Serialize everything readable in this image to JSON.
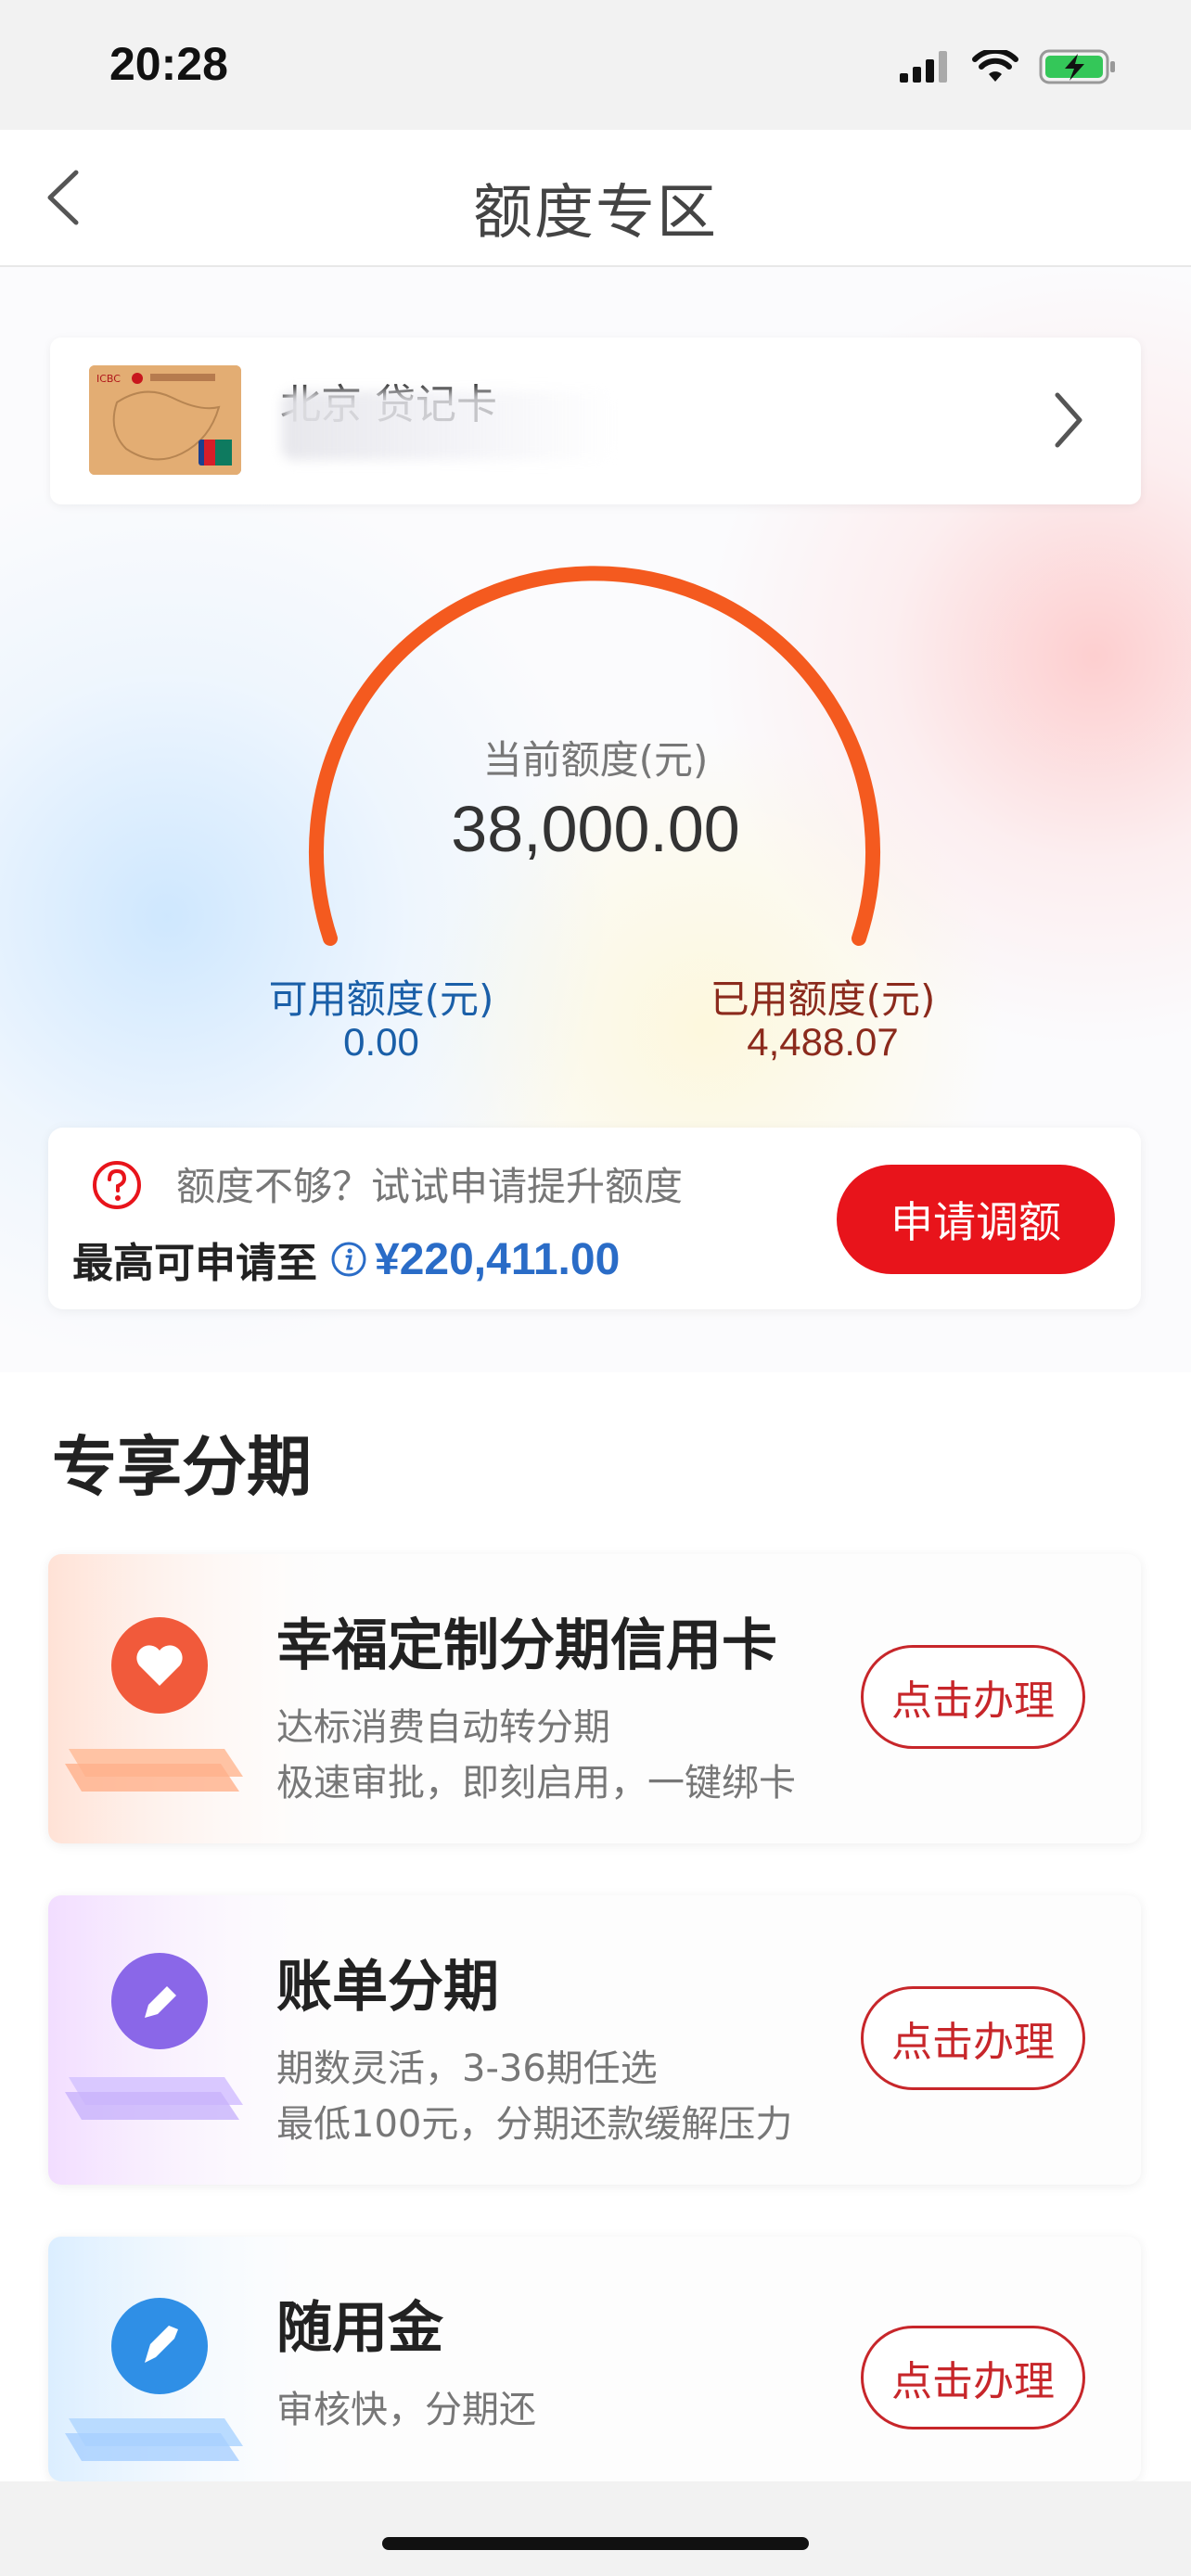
{
  "status_bar": {
    "time": "20:28"
  },
  "nav": {
    "title": "额度专区"
  },
  "card": {
    "name": "北京 贷记卡"
  },
  "gauge": {
    "label": "当前额度(元)",
    "value": "38,000.00",
    "available_label": "可用额度(元)",
    "available_value": "0.00",
    "used_label": "已用额度(元)",
    "used_value": "4,488.07"
  },
  "promo": {
    "text": "额度不够？试试申请提升额度",
    "max_label": "最高可申请至",
    "max_amount": "¥220,411.00",
    "button": "申请调额"
  },
  "section": {
    "title": "专享分期",
    "items": [
      {
        "title": "幸福定制分期信用卡",
        "desc1": "达标消费自动转分期",
        "desc2": "极速审批，即刻启用，一键绑卡",
        "button": "点击办理",
        "color": "#f15a3b"
      },
      {
        "title": "账单分期",
        "desc1": "期数灵活，3-36期任选",
        "desc2": "最低100元，分期还款缓解压力",
        "button": "点击办理",
        "color": "#8a67e8"
      },
      {
        "title": "随用金",
        "desc1": "审核快，分期还",
        "desc2": "",
        "button": "点击办理",
        "color": "#2f8fe6"
      }
    ]
  },
  "colors": {
    "accent_red": "#e8141b",
    "gauge_orange": "#f45a1f",
    "blue": "#1a5fa8"
  }
}
